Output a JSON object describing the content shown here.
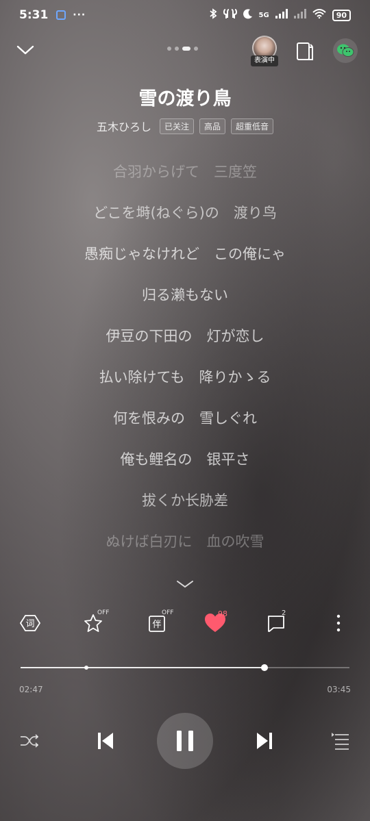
{
  "status_bar": {
    "time": "5:31",
    "dots": "···",
    "network": "5G",
    "battery": "90"
  },
  "header": {
    "avatar_badge": "表演中"
  },
  "song": {
    "title": "雪の渡り鳥",
    "artist": "五木ひろし",
    "tags": [
      "已关注",
      "高品",
      "超重低音"
    ]
  },
  "lyrics": [
    "合羽からげて　三度笠",
    "どこを塒(ねぐら)の　渡り鸟",
    "愚痴じゃなけれど　この俺にゃ",
    "归る濑もない",
    "伊豆の下田の　灯が恋し",
    "払い除けても　降りかゝる",
    "何を恨みの　雪しぐれ",
    "俺も鲤名の　银平さ",
    "拔くか长胁差",
    "ぬけば白刃に　血の吹雪"
  ],
  "actions": {
    "effect_badge": "OFF",
    "accompany_badge": "OFF",
    "like_count": "98",
    "comment_count": "2"
  },
  "playback": {
    "current_time": "02:47",
    "total_time": "03:45",
    "progress": 0.742,
    "marker": 0.2
  },
  "colors": {
    "heart": "#ff5a6e",
    "wechat": "#3ec46d"
  }
}
